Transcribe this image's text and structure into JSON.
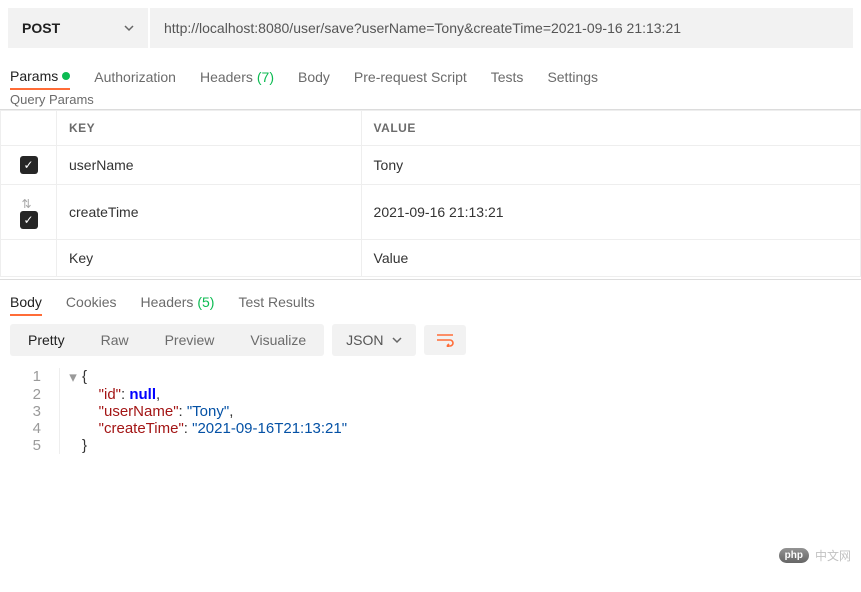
{
  "request": {
    "method": "POST",
    "url": "http://localhost:8080/user/save?userName=Tony&createTime=2021-09-16 21:13:21"
  },
  "req_tabs": {
    "params": "Params",
    "authorization": "Authorization",
    "headers": "Headers",
    "headers_count": "(7)",
    "body": "Body",
    "prerequest": "Pre-request Script",
    "tests": "Tests",
    "settings": "Settings"
  },
  "section_label": "Query Params",
  "table": {
    "header_key": "KEY",
    "header_value": "VALUE",
    "rows": [
      {
        "key": "userName",
        "value": "Tony"
      },
      {
        "key": "createTime",
        "value": "2021-09-16 21:13:21"
      }
    ],
    "placeholder_key": "Key",
    "placeholder_value": "Value"
  },
  "resp_tabs": {
    "body": "Body",
    "cookies": "Cookies",
    "headers": "Headers",
    "headers_count": "(5)",
    "test_results": "Test Results"
  },
  "view_bar": {
    "pretty": "Pretty",
    "raw": "Raw",
    "preview": "Preview",
    "visualize": "Visualize",
    "lang": "JSON"
  },
  "response_json": {
    "lines": [
      {
        "n": "1",
        "indent": "",
        "kind": "open",
        "text": "{"
      },
      {
        "n": "2",
        "indent": "    ",
        "kind": "kv_null",
        "key": "\"id\"",
        "val": "null",
        "comma": ","
      },
      {
        "n": "3",
        "indent": "    ",
        "kind": "kv_str",
        "key": "\"userName\"",
        "val": "\"Tony\"",
        "comma": ","
      },
      {
        "n": "4",
        "indent": "    ",
        "kind": "kv_str",
        "key": "\"createTime\"",
        "val": "\"2021-09-16T21:13:21\"",
        "comma": ""
      },
      {
        "n": "5",
        "indent": "",
        "kind": "close",
        "text": "}"
      }
    ]
  },
  "watermark": {
    "badge": "php",
    "text": "中文网"
  }
}
